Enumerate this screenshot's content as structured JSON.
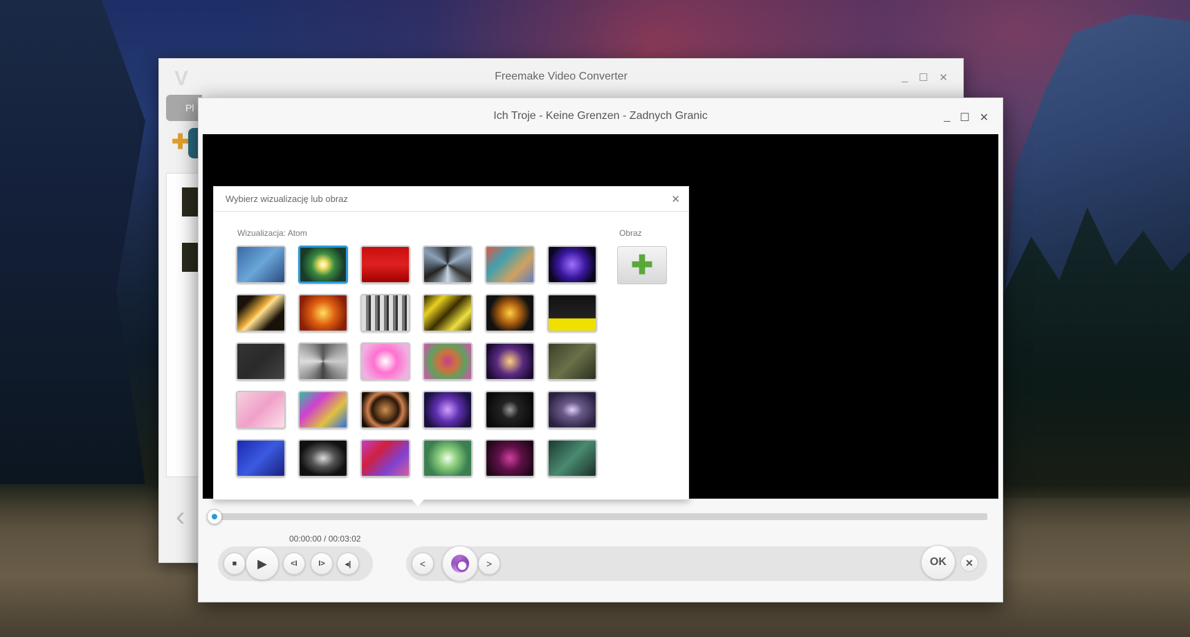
{
  "background_window": {
    "title": "Freemake Video Converter",
    "tab_label": "Pl",
    "controls": {
      "minimize": "_",
      "maximize": "☐",
      "close": "✕"
    },
    "back_arrow": "‹"
  },
  "main_window": {
    "title": "Ich Troje - Keine Grenzen - Zadnych Granic",
    "controls": {
      "minimize": "_",
      "maximize": "☐",
      "close": "✕"
    }
  },
  "popup": {
    "title": "Wybierz wizualizację lub obraz",
    "close": "✕",
    "visualization_label": "Wizualizacja: Atom",
    "image_label": "Obraz",
    "add_image": "✚",
    "selected_index": 1,
    "tiles": [
      "linear-gradient(135deg,#3a6aa8,#6aa6d8,#2a4a80)",
      "radial-gradient(circle,#ffffff 0%,#f0e060 15%,#3a8a40 40%,#1a3a2a 75%)",
      "linear-gradient(180deg,#c80e0e,#e02020,#a00000)",
      "conic-gradient(#222,#9ab0c8,#333,#c8d8e8,#222,#8aa0b8,#222)",
      "linear-gradient(135deg,#e05a40,#40a0b0,#d0a060,#6080c0)",
      "radial-gradient(circle,#a070ff 0%,#3a18a0 45%,#0a0520 80%)",
      "linear-gradient(135deg,#1a1208 20%,#f0b040 45%,#ffe090 50%,#1a1208 75%)",
      "radial-gradient(circle,#ffe060 0%,#e06010 40%,#8a2008 80%)",
      "repeating-linear-gradient(90deg,#ddd 0 6px,#777 6px 10px,#333 10px 13px)",
      "linear-gradient(135deg,#2a2200,#e8d020,#3a2e00,#f0e040,#2a2200)",
      "radial-gradient(circle,#ffd040 0%,#b06010 35%,#111 70%)",
      "linear-gradient(180deg,#111 0%,#222 65%,#f0e000 66%,#f0e000 100%)",
      "linear-gradient(135deg,#333,#2a2a2a,#444)",
      "conic-gradient(#555,#ccc,#444,#ddd,#555)",
      "radial-gradient(circle,#ffffff 0%,#ff70d0 40%,#f0b0e0 80%)",
      "radial-gradient(circle,#c04090 0%,#d07040 30%,#60a060 60%,#c060a0 90%)",
      "radial-gradient(circle,#ffd080 0%,#5a2a80 45%,#1a0a30 85%)",
      "linear-gradient(135deg,#3a4028,#6a7048,#2a3020)",
      "linear-gradient(135deg,#f6d0e0,#f0a0c8,#fce0ea)",
      "linear-gradient(135deg,#30c0a0,#d040d0,#e0c040,#3070e0)",
      "radial-gradient(circle,#d09050 0%,#2a1608 45%,#d08050 60%,#1a0e04 85%)",
      "radial-gradient(circle,#d0a0ff 0%,#6030b0 40%,#1a1040 80%)",
      "radial-gradient(circle,#999 0%,#222 30%,#0a0a0a 80%)",
      "radial-gradient(ellipse,#e0d0ff 0%,#6a5a8a 30%,#2a2040 80%)",
      "linear-gradient(135deg,#1a2ab0,#3a5ae0,#1a2080)",
      "radial-gradient(ellipse,#ddd 0%,#555 35%,#111 70%)",
      "linear-gradient(135deg,#c040c0,#d02040,#8040d0,#d060a0)",
      "radial-gradient(circle,#f0fff0 0%,#90d080 30%,#3a8050 70%)",
      "radial-gradient(circle,#d040a0 0%,#601048 40%,#200818 85%)",
      "linear-gradient(135deg,#1a3a30,#4a8a70,#1a3028)"
    ]
  },
  "player": {
    "time_readout": "00:00:00 / 00:03:02",
    "progress": 0,
    "buttons": {
      "stop": "■",
      "play": "▶",
      "prev_frame": "<I",
      "next_frame": "I>",
      "volume": "◂|",
      "prev": "<",
      "next": ">",
      "ok": "OK",
      "cancel": "✕"
    }
  },
  "colors": {
    "accent": "#2b9bd8",
    "add_icon": "#5aa83a",
    "swirl": "#9b50c4"
  }
}
